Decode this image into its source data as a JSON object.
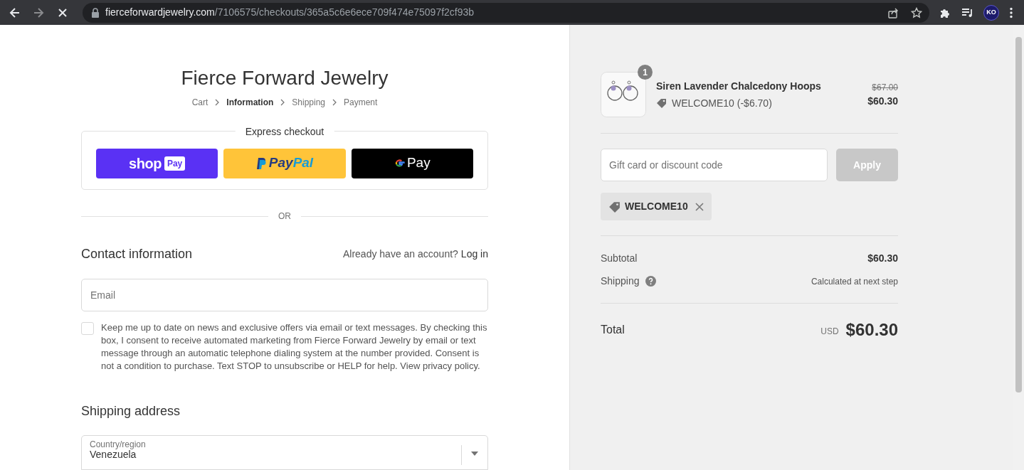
{
  "browser": {
    "url_domain": "fierceforwardjewelry.com",
    "url_path": "/7106575/checkouts/365a5c6e6ece709f474e75097f2cf93b",
    "profile_initials": "KO",
    "loading": true
  },
  "store_name": "Fierce Forward Jewelry",
  "breadcrumbs": [
    {
      "label": "Cart",
      "selected": false
    },
    {
      "label": "Information",
      "selected": true
    },
    {
      "label": "Shipping",
      "selected": false
    },
    {
      "label": "Payment",
      "selected": false
    }
  ],
  "express_checkout": {
    "title": "Express checkout",
    "buttons": [
      {
        "kind": "shop_pay",
        "label": "shop",
        "badge": "Pay"
      },
      {
        "kind": "paypal",
        "label": "Pay",
        "label_2": "Pal"
      },
      {
        "kind": "google_pay",
        "label": "Pay"
      }
    ]
  },
  "divider_text": "OR",
  "contact": {
    "heading": "Contact information",
    "account_prompt": "Already have an account?",
    "login_link": "Log in",
    "email_placeholder": "Email",
    "marketing_opt_in": {
      "checked": false,
      "text": "Keep me up to date on news and exclusive offers via email or text messages. By checking this box, I consent to receive automated marketing from Fierce Forward Jewelry by email or text message through an automatic telephone dialing system at the number provided. Consent is not a condition to purchase. Text STOP to unsubscribe or HELP for help. View privacy policy."
    }
  },
  "shipping_address": {
    "heading": "Shipping address",
    "country_label": "Country/region",
    "country_value": "Venezuela"
  },
  "summary": {
    "items": [
      {
        "name": "Siren Lavender Chalcedony Hoops",
        "quantity": "1",
        "discount": "WELCOME10 (-$6.70)",
        "original_price": "$67.00",
        "price": "$60.30"
      }
    ],
    "discount_placeholder": "Gift card or discount code",
    "apply_button": {
      "label": "Apply",
      "disabled": true
    },
    "applied_codes": [
      {
        "code": "WELCOME10"
      }
    ],
    "subtotal_label": "Subtotal",
    "subtotal_value": "$60.30",
    "shipping_label": "Shipping",
    "shipping_value": "Calculated at next step",
    "total_label": "Total",
    "currency": "USD",
    "total_value": "$60.30"
  }
}
